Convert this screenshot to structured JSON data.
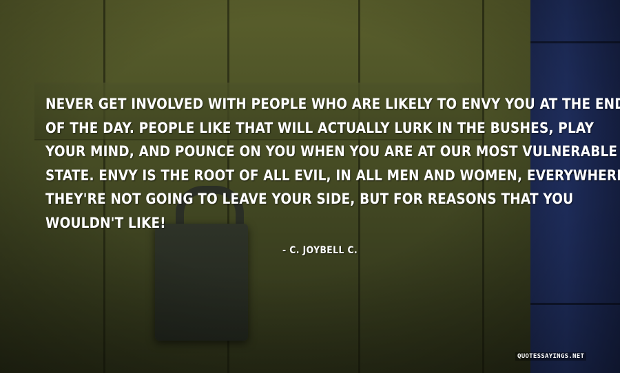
{
  "quote": {
    "lines": [
      "NEVER GET INVOLVED WITH PEOPLE WHO ARE LIKELY TO ENVY YOU AT THE END",
      "OF THE DAY. PEOPLE LIKE THAT WILL ACTUALLY LURK IN THE BUSHES, PLAY",
      "YOUR MIND, AND POUNCE ON YOU WHEN YOU ARE AT OUR MOST VULNERABLE",
      "STATE. ENVY IS THE ROOT OF ALL EVIL, IN ALL MEN AND WOMEN, EVERYWHERE.",
      "THEY'RE NOT GOING TO LEAVE YOUR SIDE, BUT FOR REASONS THAT YOU",
      "WOULDN'T LIKE!"
    ]
  },
  "author": "- C. JOYBELL C.",
  "watermark": "QUOTESSAYINGS.NET",
  "colors": {
    "text": "#ffffff",
    "wood": "#4a5026",
    "blue_panel": "#23346a"
  }
}
